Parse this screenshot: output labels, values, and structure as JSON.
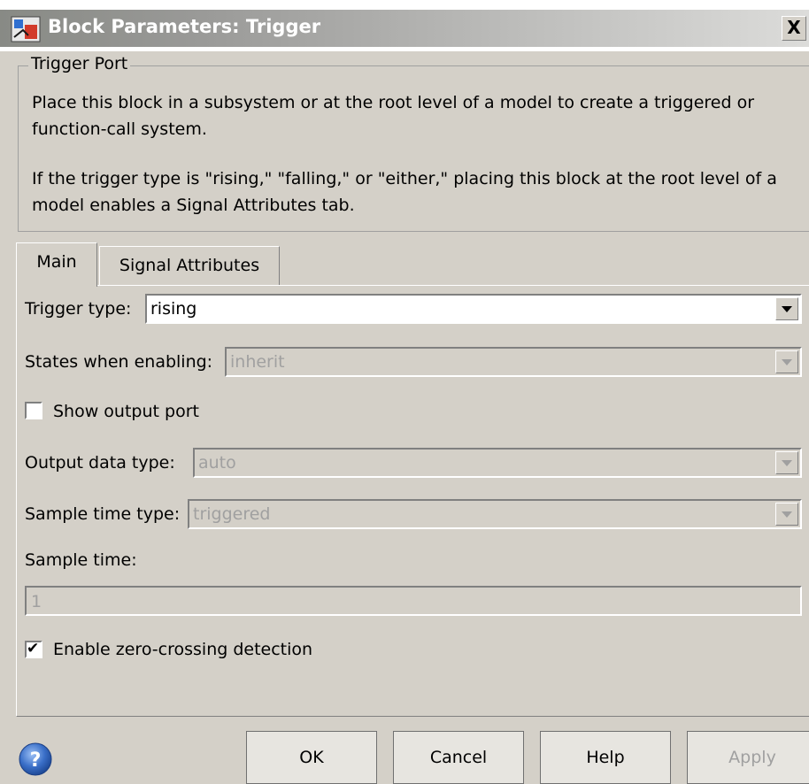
{
  "window": {
    "title": "Block Parameters: Trigger",
    "close_glyph": "X",
    "app_icon": "simulink-block-icon",
    "close_icon": "close-icon"
  },
  "group": {
    "title": "Trigger Port",
    "description_1": "Place this block in a subsystem or at the root level of a model to create a triggered or",
    "description_2": "function-call system.",
    "description_3": "If the trigger type is \"rising,\" \"falling,\" or \"either,\" placing this block at the root level of a",
    "description_4": "model enables a Signal Attributes tab."
  },
  "tabs": [
    {
      "label": "Main",
      "active": true
    },
    {
      "label": "Signal Attributes",
      "active": false
    }
  ],
  "params": {
    "trigger_type_label": "Trigger type:",
    "trigger_type_value": "rising",
    "states_label": "States when enabling:",
    "states_value": "inherit",
    "show_output_label": "Show output port",
    "show_output_checked": false,
    "output_type_label": "Output data type:",
    "output_type_value": "auto",
    "sample_time_type_label": "Sample time type:",
    "sample_time_type_value": "triggered",
    "sample_time_label": "Sample time:",
    "sample_time_value": "1",
    "zero_crossing_label": "Enable zero-crossing detection",
    "zero_crossing_checked": true,
    "check_glyph": "✔"
  },
  "buttons": {
    "ok": "OK",
    "cancel": "Cancel",
    "help": "Help",
    "apply": "Apply",
    "help_icon": "help-icon"
  },
  "colors": {
    "window_bg": "#d4d0c8",
    "title_gradient_start": "#888a85",
    "help_icon_blue": "#2f5fb3"
  }
}
